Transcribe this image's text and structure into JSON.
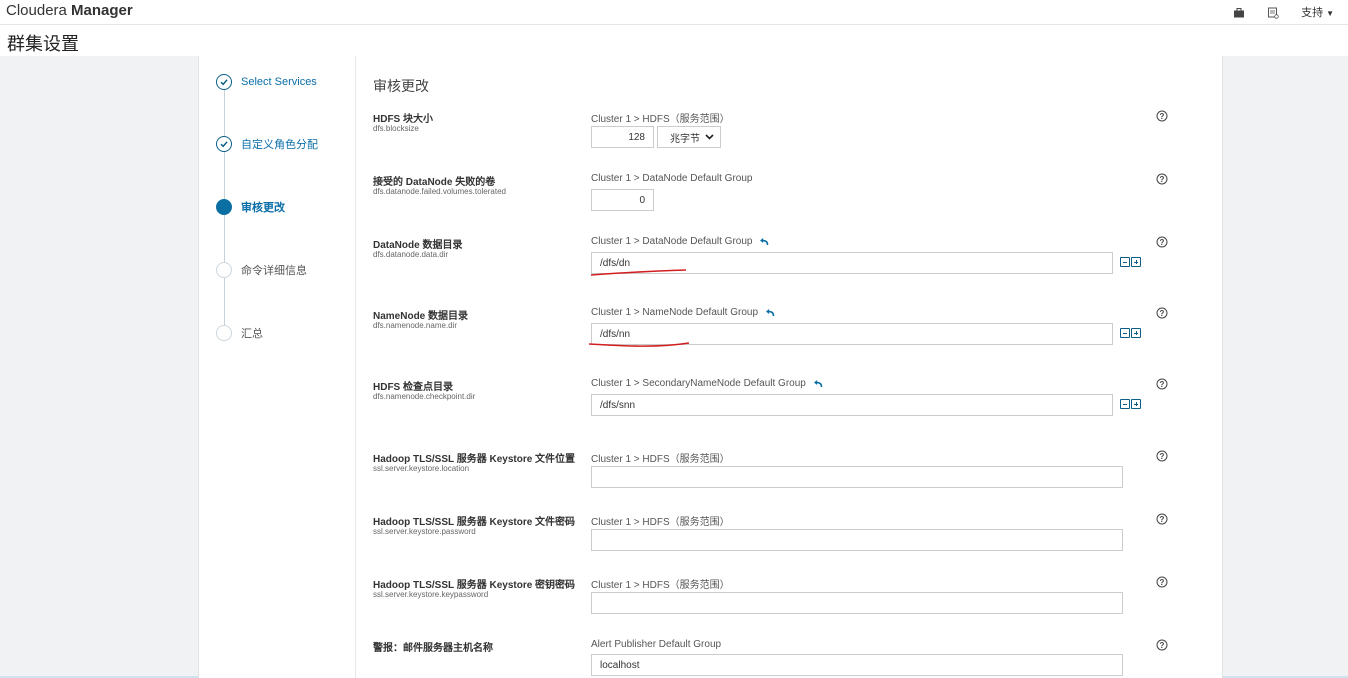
{
  "app": {
    "brand_light": "Cloudera",
    "brand_bold": "Manager",
    "support_label": "支持"
  },
  "page": {
    "title": "群集设置"
  },
  "steps": [
    {
      "label": "Select Services",
      "state": "done"
    },
    {
      "label": "自定义角色分配",
      "state": "done"
    },
    {
      "label": "审核更改",
      "state": "current"
    },
    {
      "label": "命令详细信息",
      "state": "todo"
    },
    {
      "label": "汇总",
      "state": "todo"
    }
  ],
  "review": {
    "title": "审核更改",
    "properties": [
      {
        "title": "HDFS 块大小",
        "key": "dfs.blocksize",
        "scope": "Cluster 1 > HDFS（服务范围）",
        "value": "128",
        "unit": "兆字节"
      },
      {
        "title": "接受的 DataNode 失败的卷",
        "key": "dfs.datanode.failed.volumes.tolerated",
        "scope": "Cluster 1 > DataNode Default Group",
        "value": "0"
      },
      {
        "title": "DataNode 数据目录",
        "key": "dfs.datanode.data.dir",
        "scope": "Cluster 1 > DataNode Default Group",
        "value": "/dfs/dn"
      },
      {
        "title": "NameNode 数据目录",
        "key": "dfs.namenode.name.dir",
        "scope": "Cluster 1 > NameNode Default Group",
        "value": "/dfs/nn"
      },
      {
        "title": "HDFS 检查点目录",
        "key": "dfs.namenode.checkpoint.dir",
        "scope": "Cluster 1 > SecondaryNameNode Default Group",
        "value": "/dfs/snn"
      },
      {
        "title": "Hadoop TLS/SSL 服务器 Keystore 文件位置",
        "key": "ssl.server.keystore.location",
        "scope": "Cluster 1 > HDFS（服务范围）",
        "value": ""
      },
      {
        "title": "Hadoop TLS/SSL 服务器 Keystore 文件密码",
        "key": "ssl.server.keystore.password",
        "scope": "Cluster 1 > HDFS（服务范围）",
        "value": ""
      },
      {
        "title": "Hadoop TLS/SSL 服务器 Keystore 密钥密码",
        "key": "ssl.server.keystore.keypassword",
        "scope": "Cluster 1 > HDFS（服务范围）",
        "value": ""
      },
      {
        "title": "警报：邮件服务器主机名称",
        "key": "",
        "scope": "Alert Publisher Default Group",
        "value": "localhost"
      }
    ]
  },
  "icons": {
    "top_right": [
      "briefcase-icon",
      "user-notes-icon"
    ],
    "help": "help-circle-icon",
    "undo": "undo-arrow-icon",
    "add_remove": "minus-plus-icon"
  },
  "colors": {
    "accent": "#0b6fa3",
    "annotation": "#d21e1e"
  }
}
